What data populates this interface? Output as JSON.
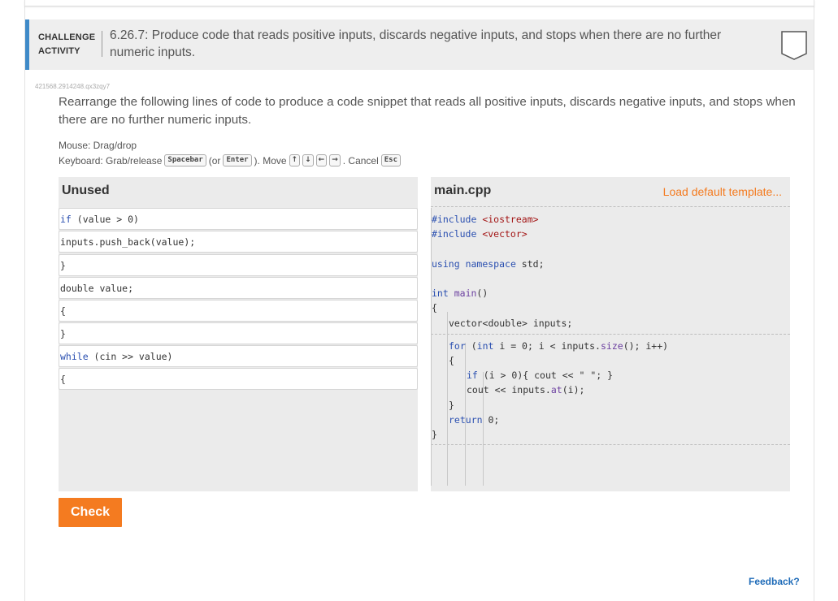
{
  "activity": {
    "label_line1": "CHALLENGE",
    "label_line2": "ACTIVITY",
    "title": "6.26.7: Produce code that reads positive inputs, discards negative inputs, and stops when there are no further numeric inputs.",
    "id": "421568.2914248.qx3zqy7",
    "instructions": "Rearrange the following lines of code to produce a code snippet that reads all positive inputs, discards negative inputs, and stops when there are no further numeric inputs."
  },
  "controls": {
    "mouse": "Mouse: Drag/drop",
    "kb_prefix": "Keyboard: Grab/release",
    "key_spacebar": "Spacebar",
    "kb_or": "(or",
    "key_enter": "Enter",
    "kb_move": "). Move",
    "key_up": "↑",
    "key_down": "↓",
    "key_left": "←",
    "key_right": "→",
    "kb_cancel": ". Cancel",
    "key_esc": "Esc"
  },
  "unused": {
    "title": "Unused",
    "blocks": [
      {
        "kw": "if",
        "rest": " (value > 0)"
      },
      {
        "kw": "",
        "rest": "inputs.push_back(value);"
      },
      {
        "kw": "",
        "rest": "}"
      },
      {
        "kw": "",
        "rest": "double value;"
      },
      {
        "kw": "",
        "rest": "{"
      },
      {
        "kw": "",
        "rest": "}"
      },
      {
        "kw": "while",
        "rest": " (cin >> value)"
      },
      {
        "kw": "",
        "rest": "{"
      }
    ]
  },
  "editor": {
    "title": "main.cpp",
    "load_template": "Load default template...",
    "lines": {
      "l1a": "#include",
      "l1b": " <iostream>",
      "l2a": "#include",
      "l2b": " <vector>",
      "l3a": "using",
      "l3b": " ",
      "l3c": "namespace",
      "l3d": " std;",
      "l4a": "int",
      "l4b": " ",
      "l4c": "main",
      "l4d": "()",
      "l5": "{",
      "l6": "vector<double> inputs;",
      "l7a": "for",
      "l7b": " (",
      "l7c": "int",
      "l7d": " i = 0; i < inputs.",
      "l7e": "size",
      "l7f": "(); i++)",
      "l8": "{",
      "l9a": "if",
      "l9b": " (i > 0){ cout << \" \"; }",
      "l10a": "cout << inputs.",
      "l10b": "at",
      "l10c": "(i);",
      "l11": "}",
      "l12a": "return",
      "l12b": " 0;",
      "l13": "}"
    }
  },
  "check_label": "Check",
  "feedback_label": "Feedback?",
  "colors": {
    "accent": "#f47b20",
    "link": "#1e6bb8",
    "header_bar": "#3f8ac8",
    "keyword": "#2a4fb0",
    "string": "#a31515"
  }
}
